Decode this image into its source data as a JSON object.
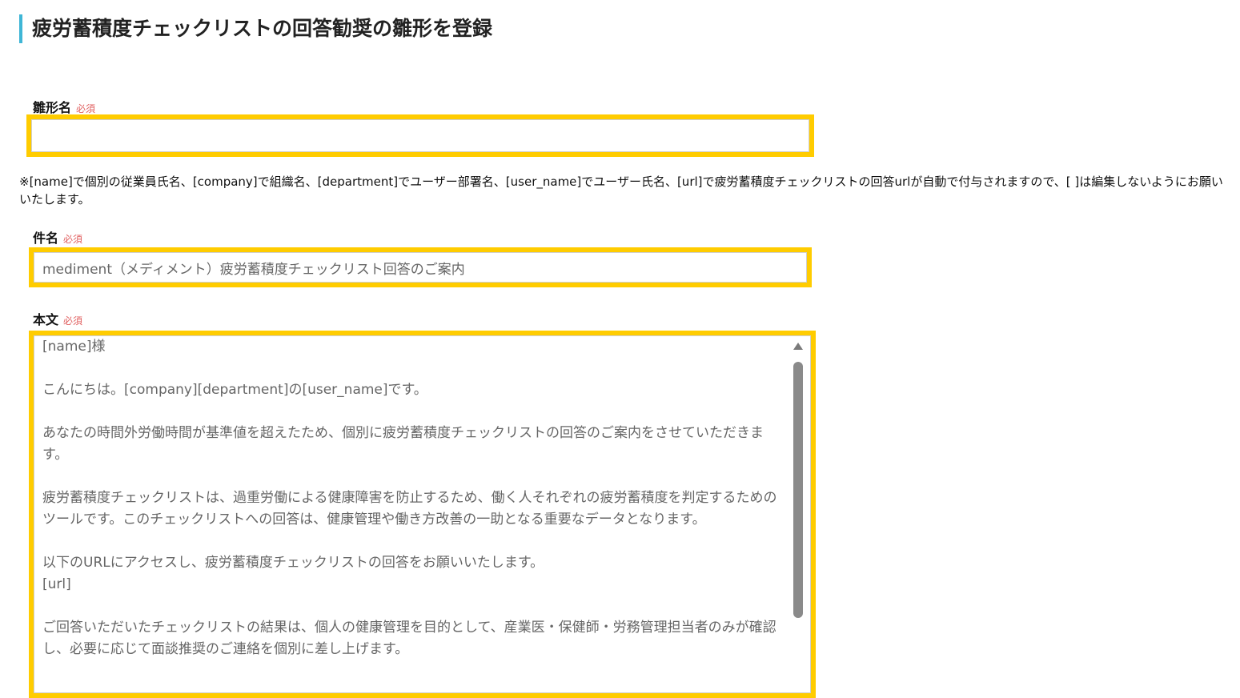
{
  "page": {
    "title": "疲労蓄積度チェックリストの回答勧奨の雛形を登録"
  },
  "template_name": {
    "label": "雛形名",
    "required": "必須",
    "value": ""
  },
  "note": "※[name]で個別の従業員氏名、[company]で組織名、[department]でユーザー部署名、[user_name]でユーザー氏名、[url]で疲労蓄積度チェックリストの回答urlが自動で付与されますので、[ ]は編集しないようにお願いいたします。",
  "subject": {
    "label": "件名",
    "required": "必須",
    "value": "mediment（メディメント）疲労蓄積度チェックリスト回答のご案内"
  },
  "body": {
    "label": "本文",
    "required": "必須",
    "lines": {
      "l1": "[name]様",
      "l2": "こんにちは。[company][department]の[user_name]です。",
      "l3": "あなたの時間外労働時間が基準値を超えたため、個別に疲労蓄積度チェックリストの回答のご案内をさせていただきます。",
      "l4": "疲労蓄積度チェックリストは、過重労働による健康障害を防止するため、働く人それぞれの疲労蓄積度を判定するためのツールです。このチェックリストへの回答は、健康管理や働き方改善の一助となる重要なデータとなります。",
      "l5": "以下のURLにアクセスし、疲労蓄積度チェックリストの回答をお願いいたします。",
      "l6": "[url]",
      "l7": "ご回答いただいたチェックリストの結果は、個人の健康管理を目的として、産業医・保健師・労務管理担当者のみが確認し、必要に応じて面談推奨のご連絡を個別に差し上げます。"
    }
  },
  "colors": {
    "title_accent": "#3fb6d6",
    "highlight": "#ffcc00",
    "required": "#e06060"
  }
}
